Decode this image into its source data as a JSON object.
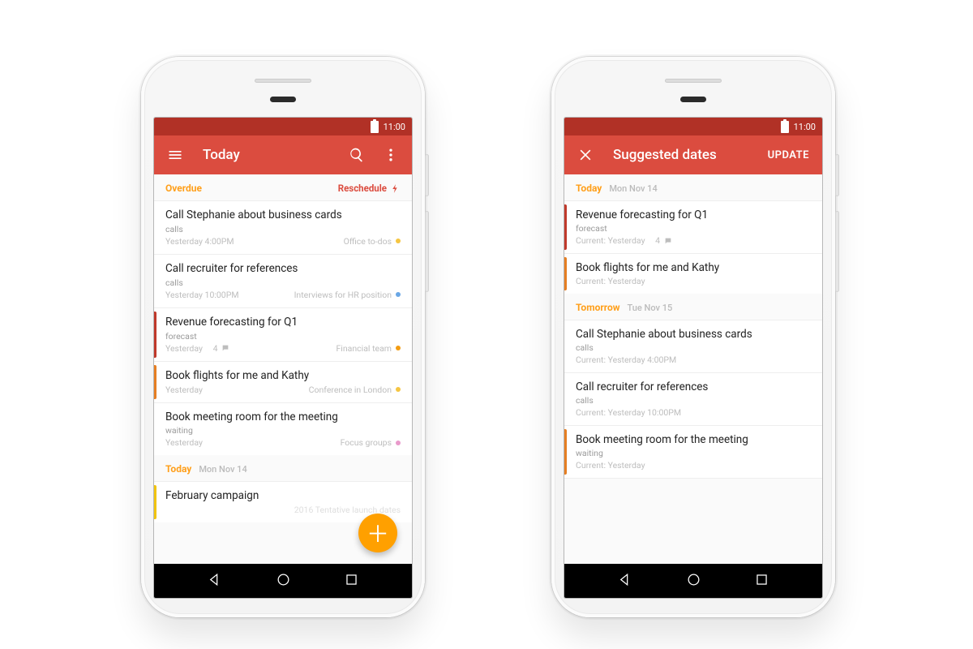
{
  "colors": {
    "appbar": "#db4c3f",
    "statusbar": "#b13126",
    "fab": "#ffa000",
    "overdue": "#ff9f1a"
  },
  "status": {
    "time": "11:00"
  },
  "left": {
    "appbar": {
      "title": "Today"
    },
    "overdue_label": "Overdue",
    "reschedule_label": "Reschedule",
    "today_header": {
      "label": "Today",
      "sub": "Mon Nov 14"
    },
    "tasks": [
      {
        "title": "Call Stephanie about business cards",
        "sub": "calls",
        "time": "Yesterday 4:00PM",
        "project": "Office to-dos",
        "project_color": "yellow",
        "priority": null
      },
      {
        "title": "Call recruiter for references",
        "sub": "calls",
        "time": "Yesterday 10:00PM",
        "project": "Interviews for HR position",
        "project_color": "blue",
        "priority": null
      },
      {
        "title": "Revenue forecasting for Q1",
        "sub": "forecast",
        "time": "Yesterday",
        "comments": 4,
        "project": "Financial team",
        "project_color": "orange",
        "priority": "red"
      },
      {
        "title": "Book flights for me and Kathy",
        "sub": null,
        "time": "Yesterday",
        "project": "Conference in London",
        "project_color": "yellow",
        "priority": "orange"
      },
      {
        "title": "Book meeting room for the meeting",
        "sub": "waiting",
        "time": "Yesterday",
        "project": "Focus groups",
        "project_color": "pink",
        "priority": null
      }
    ],
    "today_tasks": [
      {
        "title": "February campaign",
        "meta": "2016 Tentative launch dates",
        "priority": "yellow"
      }
    ]
  },
  "right": {
    "appbar": {
      "title": "Suggested dates",
      "action": "UPDATE"
    },
    "groups": [
      {
        "label": "Today",
        "sub": "Mon Nov 14",
        "tasks": [
          {
            "title": "Revenue forecasting for Q1",
            "sub": "forecast",
            "current": "Current: Yesterday",
            "comments": 4,
            "priority": "red"
          },
          {
            "title": "Book flights for me and Kathy",
            "sub": null,
            "current": "Current: Yesterday",
            "priority": "orange"
          }
        ]
      },
      {
        "label": "Tomorrow",
        "sub": "Tue Nov 15",
        "tasks": [
          {
            "title": "Call Stephanie about business cards",
            "sub": "calls",
            "current": "Current: Yesterday 4:00PM",
            "priority": null
          },
          {
            "title": "Call recruiter for references",
            "sub": "calls",
            "current": "Current: Yesterday 10:00PM",
            "priority": null
          },
          {
            "title": "Book meeting room for the meeting",
            "sub": "waiting",
            "current": "Current: Yesterday",
            "priority": "orange"
          }
        ]
      }
    ]
  }
}
